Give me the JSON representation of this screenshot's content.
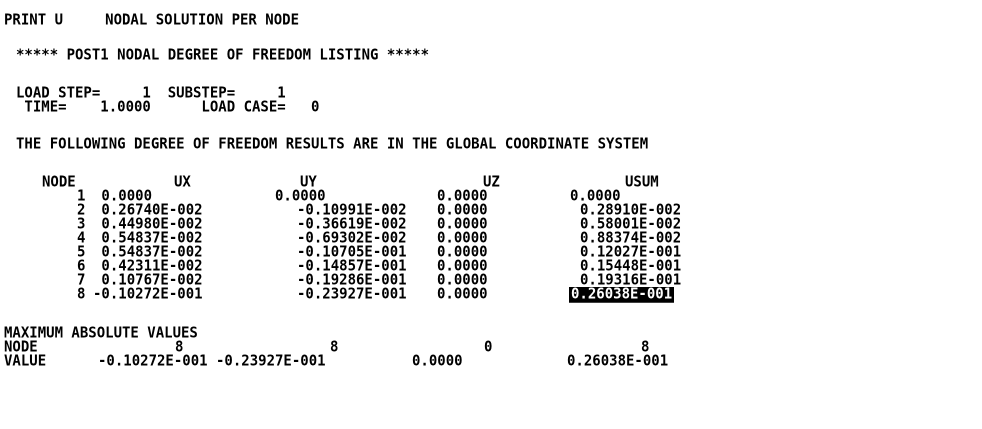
{
  "header": {
    "command": "PRINT U     NODAL SOLUTION PER NODE",
    "banner": "***** POST1 NODAL DEGREE OF FREEDOM LISTING *****"
  },
  "load": {
    "step_line": "LOAD STEP=     1  SUBSTEP=     1",
    "time_line": " TIME=    1.0000      LOAD CASE=   0"
  },
  "note": "THE FOLLOWING DEGREE OF FREEDOM RESULTS ARE IN THE GLOBAL COORDINATE SYSTEM",
  "table": {
    "headers": {
      "node": "NODE",
      "ux": "UX",
      "uy": "UY",
      "uz": "UZ",
      "usum": "USUM"
    },
    "rows": [
      {
        "node": "1",
        "ux": " 0.0000",
        "uy": "0.0000",
        "uz": "0.0000",
        "usum": "0.0000"
      },
      {
        "node": "2",
        "ux": " 0.26740E-002",
        "uy": "-0.10991E-002",
        "uz": "0.0000",
        "usum": "0.28910E-002"
      },
      {
        "node": "3",
        "ux": " 0.44980E-002",
        "uy": "-0.36619E-002",
        "uz": "0.0000",
        "usum": "0.58001E-002"
      },
      {
        "node": "4",
        "ux": " 0.54837E-002",
        "uy": "-0.69302E-002",
        "uz": "0.0000",
        "usum": "0.88374E-002"
      },
      {
        "node": "5",
        "ux": " 0.54837E-002",
        "uy": "-0.10705E-001",
        "uz": "0.0000",
        "usum": "0.12027E-001"
      },
      {
        "node": "6",
        "ux": " 0.42311E-002",
        "uy": "-0.14857E-001",
        "uz": "0.0000",
        "usum": "0.15448E-001"
      },
      {
        "node": "7",
        "ux": " 0.10767E-002",
        "uy": "-0.19286E-001",
        "uz": "0.0000",
        "usum": "0.19316E-001"
      },
      {
        "node": "8",
        "ux": "-0.10272E-001",
        "uy": "-0.23927E-001",
        "uz": "0.0000",
        "usum": "0.26038E-001",
        "selected": true
      }
    ]
  },
  "maximum": {
    "title": "MAXIMUM ABSOLUTE VALUES",
    "node_label": "NODE",
    "value_label": "VALUE",
    "node": {
      "ux": "8",
      "uy": "8",
      "uz": "0",
      "usum": "8"
    },
    "value": {
      "ux": "-0.10272E-001",
      "uy": "-0.23927E-001",
      "uz": "0.0000",
      "usum": "0.26038E-001"
    }
  },
  "colors": {
    "background": "#ffffff",
    "text": "#000000",
    "selection_background": "#000000",
    "selection_text": "#ffffff"
  }
}
